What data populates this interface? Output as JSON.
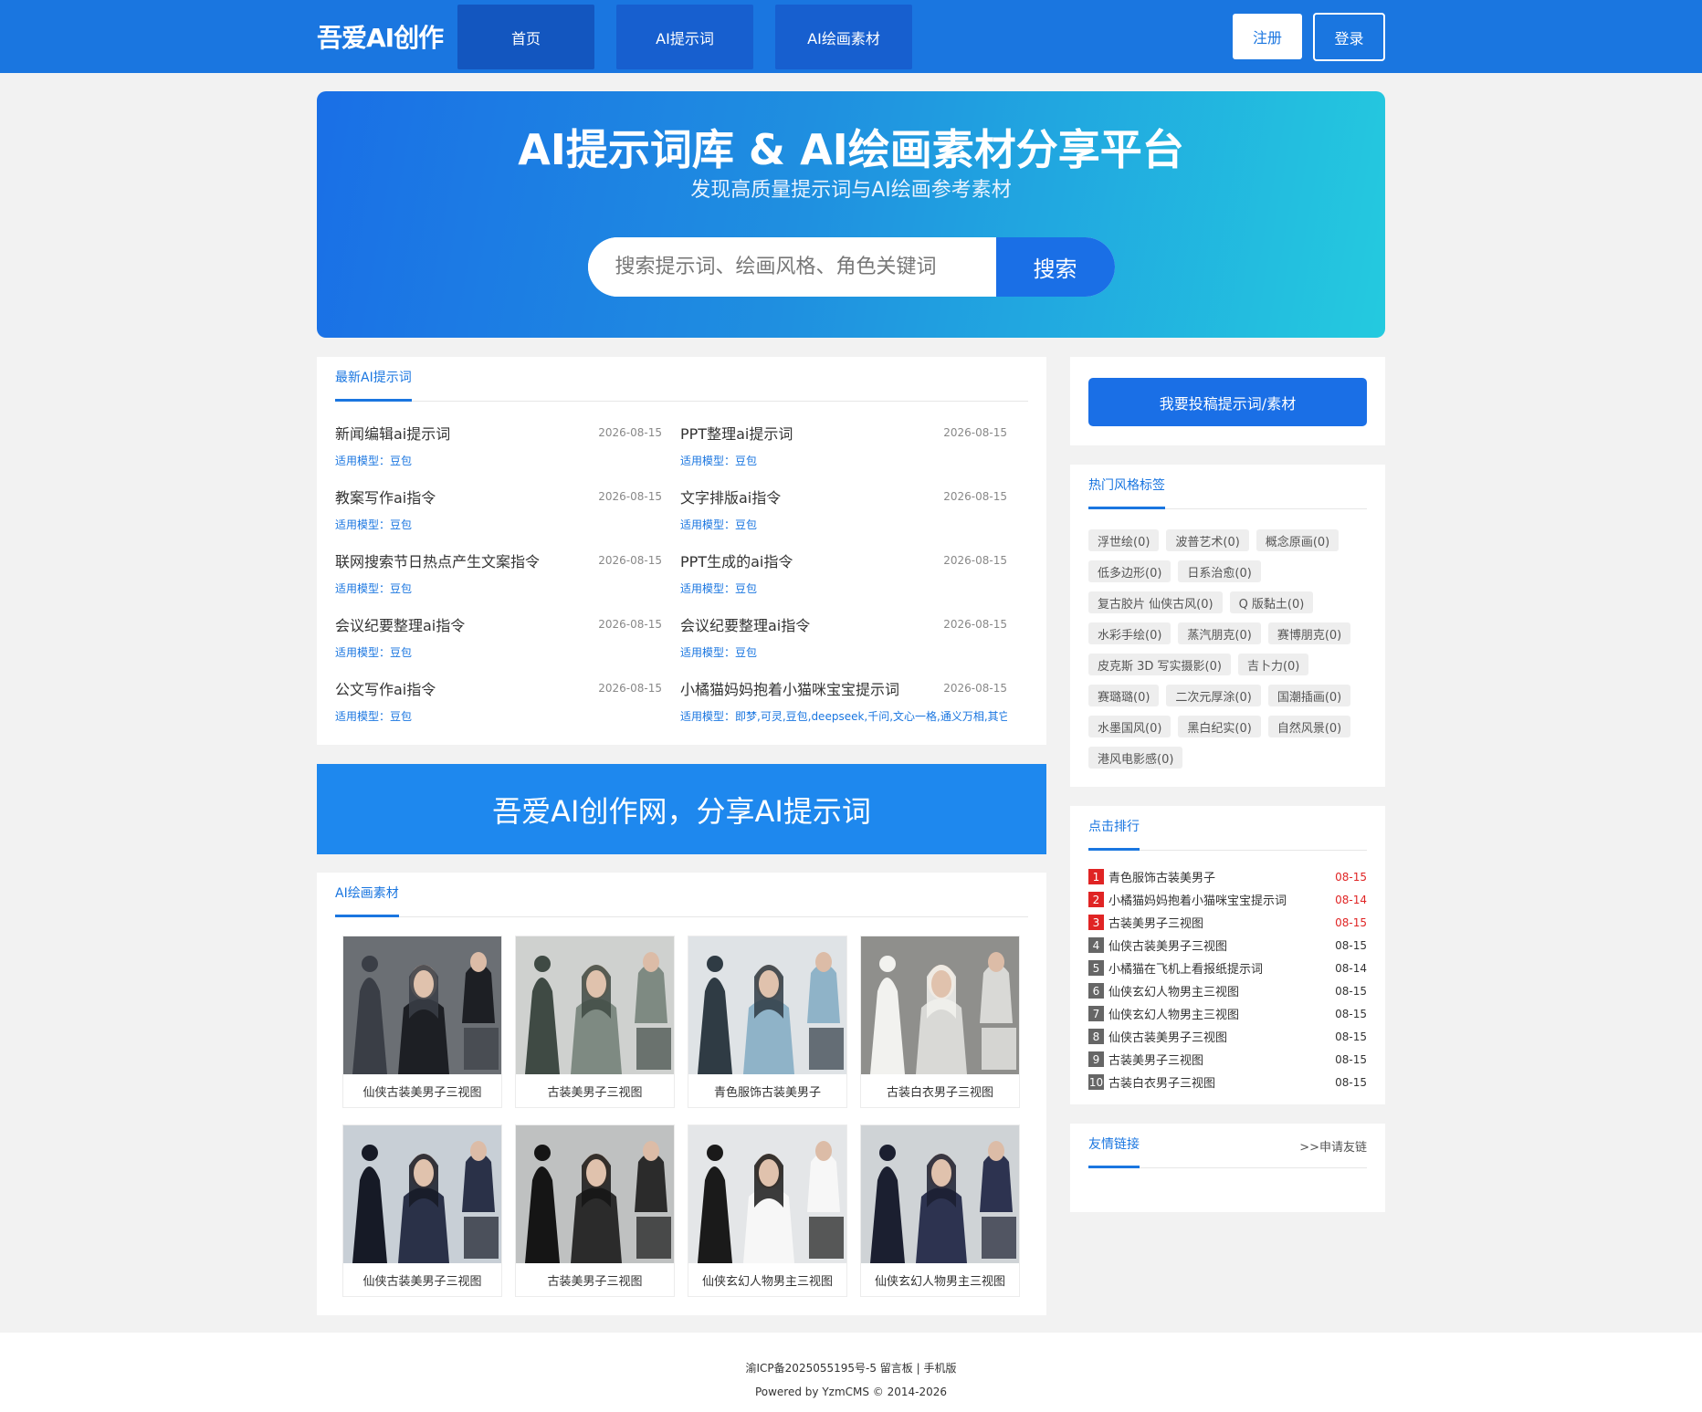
{
  "header": {
    "logo": "吾爱AI创作",
    "nav": [
      {
        "label": "首页"
      },
      {
        "label": "AI提示词"
      },
      {
        "label": "AI绘画素材"
      }
    ],
    "register": "注册",
    "login": "登录"
  },
  "hero": {
    "title": "AI提示词库 & AI绘画素材分享平台",
    "subtitle": "发现高质量提示词与AI绘画参考素材",
    "search_placeholder": "搜索提示词、绘画风格、角色关键词",
    "search_button": "搜索"
  },
  "latest": {
    "title": "最新AI提示词",
    "items": [
      {
        "title": "新闻编辑ai提示词",
        "date": "2026-08-15",
        "model": "适用模型：豆包"
      },
      {
        "title": "PPT整理ai提示词",
        "date": "2026-08-15",
        "model": "适用模型：豆包"
      },
      {
        "title": "教案写作ai指令",
        "date": "2026-08-15",
        "model": "适用模型：豆包"
      },
      {
        "title": "文字排版ai指令",
        "date": "2026-08-15",
        "model": "适用模型：豆包"
      },
      {
        "title": "联网搜索节日热点产生文案指令",
        "date": "2026-08-15",
        "model": "适用模型：豆包"
      },
      {
        "title": "PPT生成的ai指令",
        "date": "2026-08-15",
        "model": "适用模型：豆包"
      },
      {
        "title": "会议纪要整理ai指令",
        "date": "2026-08-15",
        "model": "适用模型：豆包"
      },
      {
        "title": "会议纪要整理ai指令",
        "date": "2026-08-15",
        "model": "适用模型：豆包"
      },
      {
        "title": "公文写作ai指令",
        "date": "2026-08-15",
        "model": "适用模型：豆包"
      },
      {
        "title": "小橘猫妈妈抱着小猫咪宝宝提示词",
        "date": "2026-08-15",
        "model": "适用模型：即梦,可灵,豆包,deepseek,千问,文心一格,通义万相,其它"
      }
    ]
  },
  "banner": "吾爱AI创作网，分享AI提示词",
  "gallery": {
    "title": "AI绘画素材",
    "items": [
      {
        "caption": "仙侠古装美男子三视图"
      },
      {
        "caption": "古装美男子三视图"
      },
      {
        "caption": "青色服饰古装美男子"
      },
      {
        "caption": "古装白衣男子三视图"
      },
      {
        "caption": "仙侠古装美男子三视图"
      },
      {
        "caption": "古装美男子三视图"
      },
      {
        "caption": "仙侠玄幻人物男主三视图"
      },
      {
        "caption": "仙侠玄幻人物男主三视图"
      }
    ]
  },
  "sidebar": {
    "submit": "我要投稿提示词/素材",
    "tags_title": "热门风格标签",
    "tags": [
      "浮世绘(0)",
      "波普艺术(0)",
      "概念原画(0)",
      "低多边形(0)",
      "日系治愈(0)",
      "复古胶片 仙侠古风(0)",
      "Q 版黏土(0)",
      "水彩手绘(0)",
      "蒸汽朋克(0)",
      "赛博朋克(0)",
      "皮克斯 3D 写实摄影(0)",
      "吉卜力(0)",
      "赛璐璐(0)",
      "二次元厚涂(0)",
      "国潮插画(0)",
      "水墨国风(0)",
      "黑白纪实(0)",
      "自然风景(0)",
      "港风电影感(0)"
    ],
    "rank_title": "点击排行",
    "rank": [
      {
        "num": "1",
        "title": "青色服饰古装美男子",
        "date": "08-15"
      },
      {
        "num": "2",
        "title": "小橘猫妈妈抱着小猫咪宝宝提示词",
        "date": "08-14"
      },
      {
        "num": "3",
        "title": "古装美男子三视图",
        "date": "08-15"
      },
      {
        "num": "4",
        "title": "仙侠古装美男子三视图",
        "date": "08-15"
      },
      {
        "num": "5",
        "title": "小橘猫在飞机上看报纸提示词",
        "date": "08-14"
      },
      {
        "num": "6",
        "title": "仙侠玄幻人物男主三视图",
        "date": "08-15"
      },
      {
        "num": "7",
        "title": "仙侠玄幻人物男主三视图",
        "date": "08-15"
      },
      {
        "num": "8",
        "title": "仙侠古装美男子三视图",
        "date": "08-15"
      },
      {
        "num": "9",
        "title": "古装美男子三视图",
        "date": "08-15"
      },
      {
        "num": "10",
        "title": "古装白衣男子三视图",
        "date": "08-15"
      }
    ],
    "links_title": "友情链接",
    "links_more": ">>申请友链"
  },
  "footer": {
    "line1": "渝ICP备2025055195号-5 留言板 | 手机版",
    "line2": "Powered by YzmCMS © 2014-2026"
  },
  "colors": {
    "primary": "#1a76e0",
    "rank_top": "#e02424"
  }
}
